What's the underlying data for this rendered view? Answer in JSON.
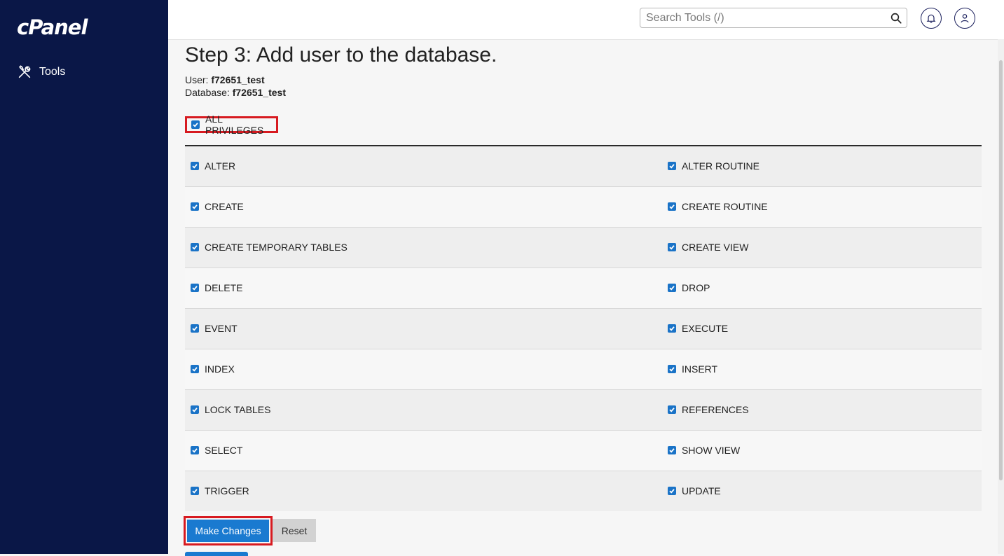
{
  "sidebar": {
    "logo": "cPanel",
    "nav": [
      {
        "label": "Tools",
        "icon": "tools-icon"
      }
    ]
  },
  "header": {
    "search_placeholder": "Search Tools (/)",
    "search_icon": "search-icon",
    "notifications_icon": "bell-icon",
    "user_icon": "user-icon"
  },
  "page": {
    "title": "Step 3: Add user to the database.",
    "user_label": "User: ",
    "user_value": "f72651_test",
    "database_label": "Database: ",
    "database_value": "f72651_test",
    "all_privileges": {
      "label": "ALL PRIVILEGES",
      "checked": true
    }
  },
  "privileges": [
    [
      "ALTER",
      "ALTER ROUTINE"
    ],
    [
      "CREATE",
      "CREATE ROUTINE"
    ],
    [
      "CREATE TEMPORARY TABLES",
      "CREATE VIEW"
    ],
    [
      "DELETE",
      "DROP"
    ],
    [
      "EVENT",
      "EXECUTE"
    ],
    [
      "INDEX",
      "INSERT"
    ],
    [
      "LOCK TABLES",
      "REFERENCES"
    ],
    [
      "SELECT",
      "SHOW VIEW"
    ],
    [
      "TRIGGER",
      "UPDATE"
    ]
  ],
  "actions": {
    "make_changes": "Make Changes",
    "reset": "Reset"
  },
  "colors": {
    "sidebar_bg": "#0a1747",
    "primary": "#1a7ad0",
    "checkbox": "#1a73c7",
    "highlight": "#d71a20"
  }
}
